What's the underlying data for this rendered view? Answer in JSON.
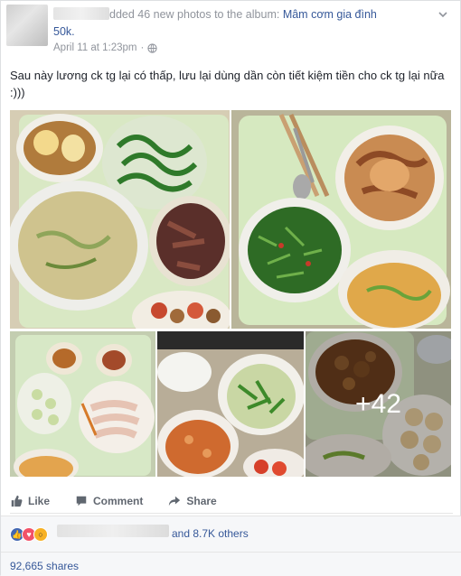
{
  "post": {
    "header_text": "dded 46 new photos to the album: ",
    "album_part1": "Mâm cơm gia đình",
    "album_part2": "50k.",
    "timestamp": "April 11 at 1:23pm",
    "privacy_sep": "·",
    "status": "Sau này lương ck tg lại có thấp, lưu lại dùng dần còn tiết kiệm tiền cho ck tg lại nữa :)))",
    "more_photos": "+42"
  },
  "actions": {
    "like": "Like",
    "comment": "Comment",
    "share": "Share"
  },
  "reactions": {
    "others_text": "and 8.7K others",
    "shares_text": "92,665 shares"
  },
  "colors": {
    "link": "#365899",
    "meta": "#90949c",
    "like": "#4267b2",
    "love": "#f25268",
    "wow": "#f7b125"
  }
}
